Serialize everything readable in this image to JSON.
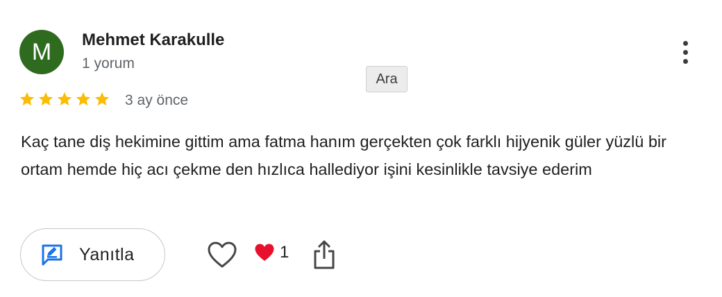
{
  "review": {
    "author": {
      "initial": "M",
      "name": "Mehmet Karakulle",
      "review_count": "1 yorum",
      "avatar_color": "#2e6b1f"
    },
    "rating": 5,
    "rating_max": 5,
    "star_color": "#fbbc04",
    "date": "3 ay önce",
    "text": "Kaç tane diş hekimine gittim ama fatma hanım gerçekten çok farklı hijyenik güler yüzlü bir ortam hemde hiç acı çekme den hızlıca hallediyor işini kesinlikle tavsiye ederim"
  },
  "tooltip": {
    "label": "Ara"
  },
  "actions": {
    "reply_label": "Yanıtla",
    "reply_icon": "reply-edit-icon",
    "like_icon": "heart-outline-icon",
    "reaction_icon": "red-heart-icon",
    "reaction_count": "1",
    "share_icon": "share-icon",
    "more_icon": "more-vert-icon",
    "accent_color": "#1a73e8",
    "heart_color": "#e8112d"
  }
}
